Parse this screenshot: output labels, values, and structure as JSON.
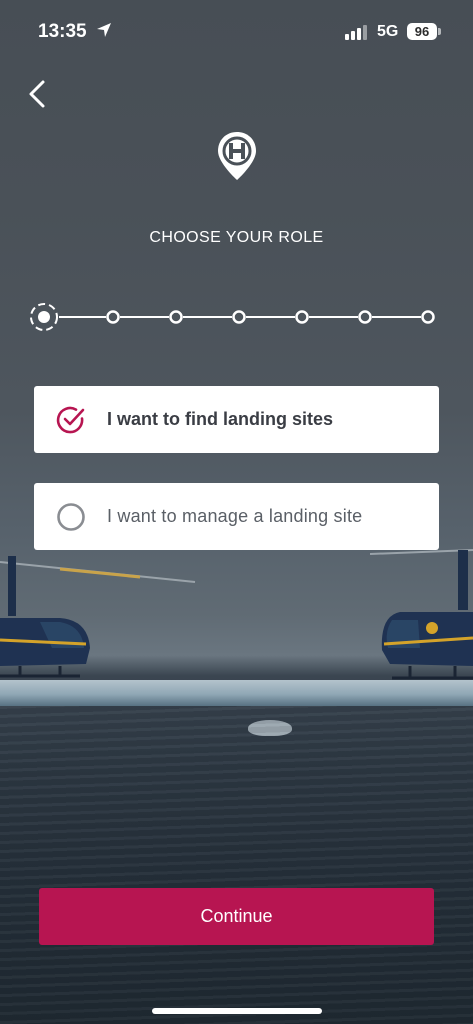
{
  "status_bar": {
    "time": "13:35",
    "network": "5G",
    "battery": "96"
  },
  "icons": {
    "back": "chevron-left-icon",
    "logo": "heliport-pin-icon",
    "location": "location-arrow-icon",
    "signal": "signal-icon"
  },
  "page": {
    "title": "CHOOSE YOUR ROLE"
  },
  "stepper": {
    "total_steps": 7,
    "current_step": 1
  },
  "options": [
    {
      "label": "I want to find landing sites",
      "selected": true
    },
    {
      "label": "I want to manage a landing site",
      "selected": false
    }
  ],
  "actions": {
    "continue_label": "Continue"
  },
  "colors": {
    "accent": "#b71551",
    "text": "#3b3f45",
    "radio_unselected": "#8a8d92"
  }
}
